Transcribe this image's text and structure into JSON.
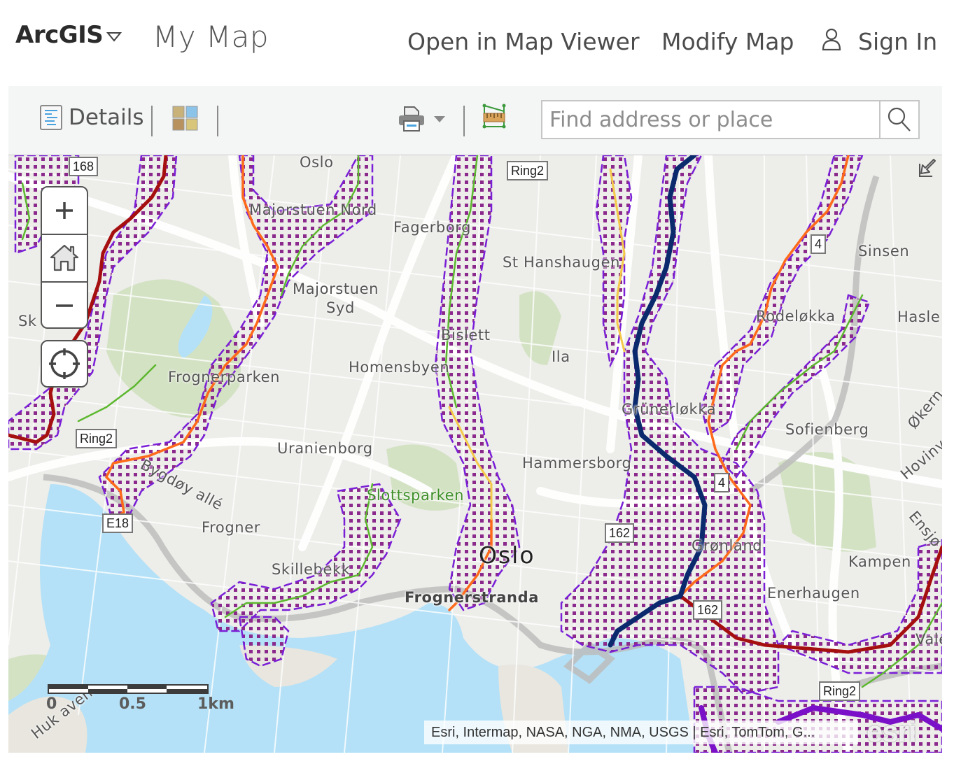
{
  "header": {
    "brand": "ArcGIS",
    "map_title": "My Map",
    "nav": {
      "open_in_map_viewer": "Open in Map Viewer",
      "modify_map": "Modify Map",
      "sign_in": "Sign In"
    }
  },
  "toolbar": {
    "details_label": "Details",
    "search_placeholder": "Find address or place",
    "search_value": ""
  },
  "map": {
    "place_labels": [
      {
        "text": "Oslo",
        "big": false
      },
      {
        "text": "Majorstuen Nord"
      },
      {
        "text": "Fagerborg"
      },
      {
        "text": "St Hanshaugen"
      },
      {
        "text": "Sinsen"
      },
      {
        "text": "Majorstuen"
      },
      {
        "text": "Syd"
      },
      {
        "text": "Rodeløkka"
      },
      {
        "text": "Hasle"
      },
      {
        "text": "Bislett"
      },
      {
        "text": "Ila"
      },
      {
        "text": "Homensbyen"
      },
      {
        "text": "Frognerparken"
      },
      {
        "text": "Grünerløkka"
      },
      {
        "text": "Sofienberg"
      },
      {
        "text": "Uranienborg"
      },
      {
        "text": "Hammersborg"
      },
      {
        "text": "Bygdøy allé"
      },
      {
        "text": "Slottsparken"
      },
      {
        "text": "Frogner"
      },
      {
        "text": "Oslo"
      },
      {
        "text": "Grønland"
      },
      {
        "text": "Kampen"
      },
      {
        "text": "Skillebekk"
      },
      {
        "text": "Enerhaugen"
      },
      {
        "text": "Frognerstranda"
      },
      {
        "text": "Sk"
      },
      {
        "text": "Økern"
      },
      {
        "text": "Hovinv"
      },
      {
        "text": "Ensjø"
      },
      {
        "text": "Vale"
      },
      {
        "text": "Huk aven"
      }
    ],
    "road_shields": [
      "168",
      "Ring2",
      "4",
      "Ring2",
      "4",
      "E18",
      "162",
      "162",
      "Ring2"
    ],
    "scale": {
      "labels": [
        "0",
        "0.5",
        "1km"
      ]
    },
    "attribution": "Esri, Intermap, NASA, NGA, NMA, USGS | Esri, TomTom, G...",
    "logo": "esri",
    "colors": {
      "water": "#b4e1f7",
      "park": "#d2e0c0",
      "buffer": "#7a1fd6",
      "route_dark_red": "#a50f0f",
      "route_orange": "#ff6a1a",
      "route_navy": "#0b2a6e",
      "route_green": "#5cb82e",
      "route_yellow": "#f4c94a",
      "route_purple": "#7a10c8"
    }
  }
}
